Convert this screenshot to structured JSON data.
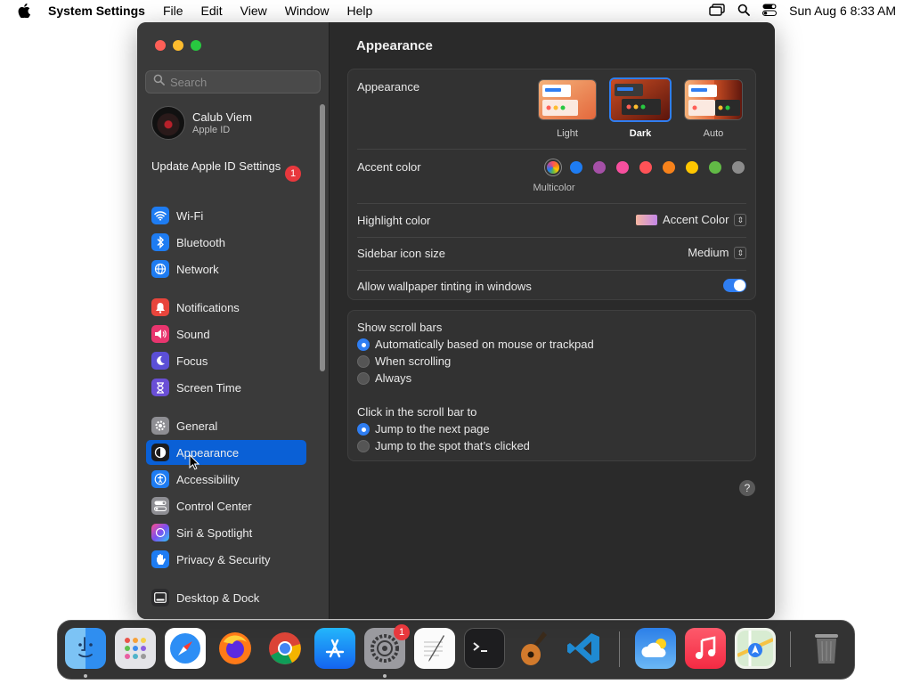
{
  "menubar": {
    "app_name": "System Settings",
    "menus": [
      "File",
      "Edit",
      "View",
      "Window",
      "Help"
    ],
    "clock": "Sun Aug 6  8:33 AM"
  },
  "sidebar": {
    "search_placeholder": "Search",
    "profile": {
      "name": "Calub Viem",
      "subtitle": "Apple ID"
    },
    "update": {
      "label": "Update Apple ID Settings",
      "badge": "1"
    },
    "items": [
      {
        "label": "Wi-Fi",
        "icon": "wifi-icon",
        "color": "#1e7cf2"
      },
      {
        "label": "Bluetooth",
        "icon": "bluetooth-icon",
        "color": "#1e7cf2"
      },
      {
        "label": "Network",
        "icon": "globe-icon",
        "color": "#1e7cf2"
      },
      {
        "label": "Notifications",
        "icon": "bell-icon",
        "color": "#e8453c"
      },
      {
        "label": "Sound",
        "icon": "speaker-icon",
        "color": "#e8356e"
      },
      {
        "label": "Focus",
        "icon": "moon-icon",
        "color": "#5b4fd6"
      },
      {
        "label": "Screen Time",
        "icon": "hourglass-icon",
        "color": "#6a4fd6"
      },
      {
        "label": "General",
        "icon": "gear-icon",
        "color": "#8e8e93"
      },
      {
        "label": "Appearance",
        "icon": "appearance-icon",
        "color": "#1c1c1e"
      },
      {
        "label": "Accessibility",
        "icon": "accessibility-icon",
        "color": "#1e7cf2"
      },
      {
        "label": "Control Center",
        "icon": "control-center-icon",
        "color": "#8e8e93"
      },
      {
        "label": "Siri & Spotlight",
        "icon": "siri-icon",
        "color": "#a04bd6"
      },
      {
        "label": "Privacy & Security",
        "icon": "hand-icon",
        "color": "#1e7cf2"
      },
      {
        "label": "Desktop & Dock",
        "icon": "dock-icon",
        "color": "#2c2c2e"
      }
    ],
    "selected": "Appearance"
  },
  "main": {
    "title": "Appearance",
    "appearance": {
      "label": "Appearance",
      "options": [
        "Light",
        "Dark",
        "Auto"
      ],
      "selected": "Dark"
    },
    "accent": {
      "label": "Accent color",
      "multicolor_label": "Multicolor",
      "colors": [
        "multicolor",
        "#1e7cf2",
        "#a550a7",
        "#f74f9e",
        "#ff5257",
        "#f7821b",
        "#ffc600",
        "#62ba46",
        "#8c8c8c"
      ]
    },
    "highlight": {
      "label": "Highlight color",
      "value": "Accent Color"
    },
    "sidebar_icon_size": {
      "label": "Sidebar icon size",
      "value": "Medium"
    },
    "wallpaper_tinting": {
      "label": "Allow wallpaper tinting in windows",
      "on": true
    },
    "scroll_bars": {
      "label": "Show scroll bars",
      "options": [
        "Automatically based on mouse or trackpad",
        "When scrolling",
        "Always"
      ],
      "selected": "Automatically based on mouse or trackpad"
    },
    "click_scroll": {
      "label": "Click in the scroll bar to",
      "options": [
        "Jump to the next page",
        "Jump to the spot that’s clicked"
      ],
      "selected": "Jump to the next page"
    },
    "help": "?"
  },
  "dock": {
    "apps": [
      "Finder",
      "Launchpad",
      "Safari",
      "Firefox",
      "Chrome",
      "App Store",
      "System Settings",
      "TextEdit",
      "Terminal",
      "GarageBand",
      "Visual Studio Code",
      "Weather",
      "Music",
      "Maps",
      "Trash"
    ],
    "settings_badge": "1"
  }
}
